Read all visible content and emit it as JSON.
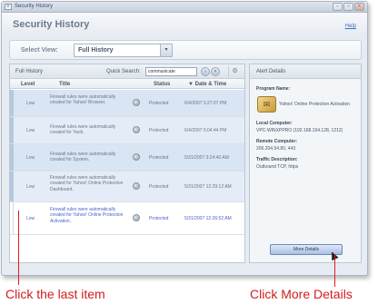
{
  "window": {
    "title": "Security History",
    "buttons": {
      "minimize": "–",
      "restore": "□",
      "close": "×"
    }
  },
  "header": {
    "title": "Security History",
    "help": "Help"
  },
  "view_bar": {
    "label": "Select View:",
    "selected": "Full History",
    "dropdown_icon": "▾"
  },
  "history": {
    "panel_title": "Full History",
    "quick_search_label": "Quick Search:",
    "search_value": "communicate",
    "columns": [
      "Level",
      "Title",
      "Status",
      "▼ Date & Time"
    ],
    "rows": [
      {
        "level": "Low",
        "title": "Firewall rules were automatically created for Yahoo! Browser.",
        "status": "Protected",
        "date": "6/4/2007 5:27:07 PM"
      },
      {
        "level": "Low",
        "title": "Firewall rules were automatically created for Yacb.",
        "status": "Protected",
        "date": "6/4/2007 5:04:44 PM"
      },
      {
        "level": "Low",
        "title": "Firewall rules were automatically created for System.",
        "status": "Protected",
        "date": "5/31/2007 3:24:40 AM"
      },
      {
        "level": "Low",
        "title": "Firewall rules were automatically created for Yahoo! Online Protection Dashboard.",
        "status": "Protected",
        "date": "5/31/2007 12:29:12 AM"
      },
      {
        "level": "Low",
        "title": "Firewall rules were automatically created for Yahoo! Online Protection Activation.",
        "status": "Protected",
        "date": "5/31/2007 12:26:52 AM"
      }
    ]
  },
  "about": {
    "panel_title": "Alert Details",
    "program_label": "Program Name:",
    "program_name": "Yahoo! Online Protection Activation",
    "local_label": "Local Computer:",
    "local_value": "VPC-WINXPPRO (192.168.154.128, 1212)",
    "remote_label": "Remote Computer:",
    "remote_value": "206.204.54.80, 443",
    "traffic_label": "Traffic Description:",
    "traffic_value": "Outbound TCP, https",
    "more_button": "More Details"
  },
  "callouts": {
    "left": "Click the last item",
    "right": "Click More Details"
  }
}
